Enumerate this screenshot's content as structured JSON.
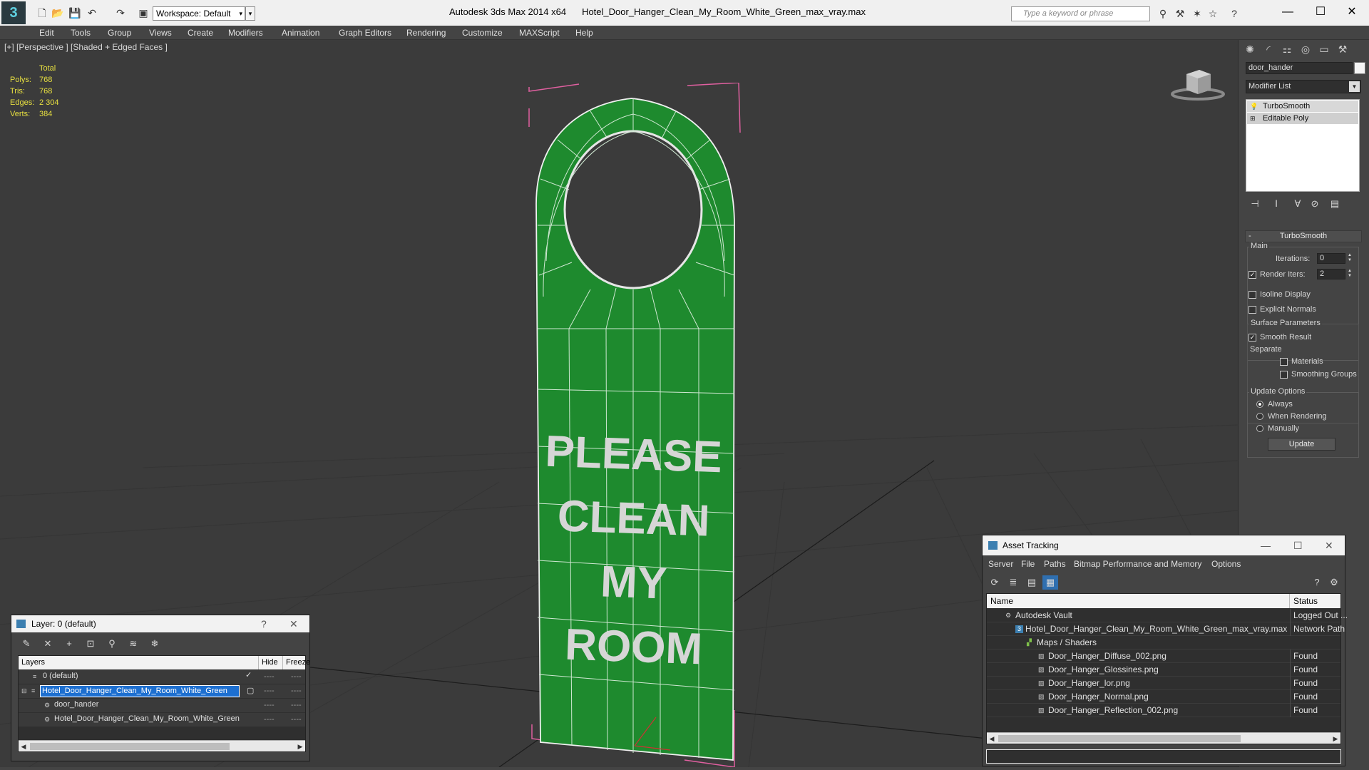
{
  "titlebar": {
    "workspace": "Workspace: Default",
    "app_name": "Autodesk 3ds Max  2014 x64",
    "file_name": "Hotel_Door_Hanger_Clean_My_Room_White_Green_max_vray.max",
    "search_placeholder": "Type a keyword or phrase"
  },
  "menu": [
    "Edit",
    "Tools",
    "Group",
    "Views",
    "Create",
    "Modifiers",
    "Animation",
    "Graph Editors",
    "Rendering",
    "Customize",
    "MAXScript",
    "Help"
  ],
  "viewport": {
    "label": "[+] [Perspective ] [Shaded + Edged Faces ]",
    "stats": {
      "header": "Total",
      "rows": [
        {
          "k": "Polys:",
          "v": "768"
        },
        {
          "k": "Tris:",
          "v": "768"
        },
        {
          "k": "Edges:",
          "v": "2 304"
        },
        {
          "k": "Verts:",
          "v": "384"
        }
      ]
    },
    "hanger_text": [
      "PLEASE",
      "CLEAN",
      "MY",
      "ROOM"
    ],
    "colors": {
      "hanger": "#1e8a2e",
      "wire": "#e8e8e8",
      "bbox": "#e060a0"
    }
  },
  "command_panel": {
    "object_name": "door_hander",
    "modifier_list": "Modifier List",
    "stack": [
      "TurboSmooth",
      "Editable Poly"
    ],
    "rollout_title": "TurboSmooth",
    "main_group": "Main",
    "iterations_label": "Iterations:",
    "iterations_value": "0",
    "render_iters_label": "Render Iters:",
    "render_iters_value": "2",
    "render_iters_checked": true,
    "isoline_label": "Isoline Display",
    "explicit_normals_label": "Explicit Normals",
    "surface_group": "Surface Parameters",
    "smooth_result_label": "Smooth Result",
    "separate_label": "Separate",
    "materials_label": "Materials",
    "smoothing_groups_label": "Smoothing Groups",
    "update_group": "Update Options",
    "update_options": [
      "Always",
      "When Rendering",
      "Manually"
    ],
    "update_selected": "Always",
    "update_button": "Update"
  },
  "layer_dialog": {
    "title": "Layer: 0 (default)",
    "help": "?",
    "close": "✕",
    "headers": {
      "layers": "Layers",
      "hide": "Hide",
      "freeze": "Freeze"
    },
    "rows": [
      {
        "name": "0 (default)",
        "indent": 1,
        "selected": false,
        "current": true
      },
      {
        "name": "Hotel_Door_Hanger_Clean_My_Room_White_Green",
        "indent": 1,
        "selected": true,
        "current": false
      },
      {
        "name": "door_hander",
        "indent": 2,
        "selected": false,
        "current": false
      },
      {
        "name": "Hotel_Door_Hanger_Clean_My_Room_White_Green",
        "indent": 2,
        "selected": false,
        "current": false
      }
    ],
    "dash": "----"
  },
  "asset_dialog": {
    "title": "Asset Tracking",
    "menu": [
      "Server",
      "File",
      "Paths",
      "Bitmap Performance and Memory",
      "Options"
    ],
    "headers": {
      "name": "Name",
      "status": "Status"
    },
    "rows": [
      {
        "name": "Autodesk Vault",
        "status": "Logged Out ...",
        "indent": 0
      },
      {
        "name": "Hotel_Door_Hanger_Clean_My_Room_White_Green_max_vray.max",
        "status": "Network Path",
        "indent": 1
      },
      {
        "name": "Maps / Shaders",
        "status": "",
        "indent": 2
      },
      {
        "name": "Door_Hanger_Diffuse_002.png",
        "status": "Found",
        "indent": 3
      },
      {
        "name": "Door_Hanger_Glossines.png",
        "status": "Found",
        "indent": 3
      },
      {
        "name": "Door_Hanger_lor.png",
        "status": "Found",
        "indent": 3
      },
      {
        "name": "Door_Hanger_Normal.png",
        "status": "Found",
        "indent": 3
      },
      {
        "name": "Door_Hanger_Reflection_002.png",
        "status": "Found",
        "indent": 3
      }
    ]
  }
}
